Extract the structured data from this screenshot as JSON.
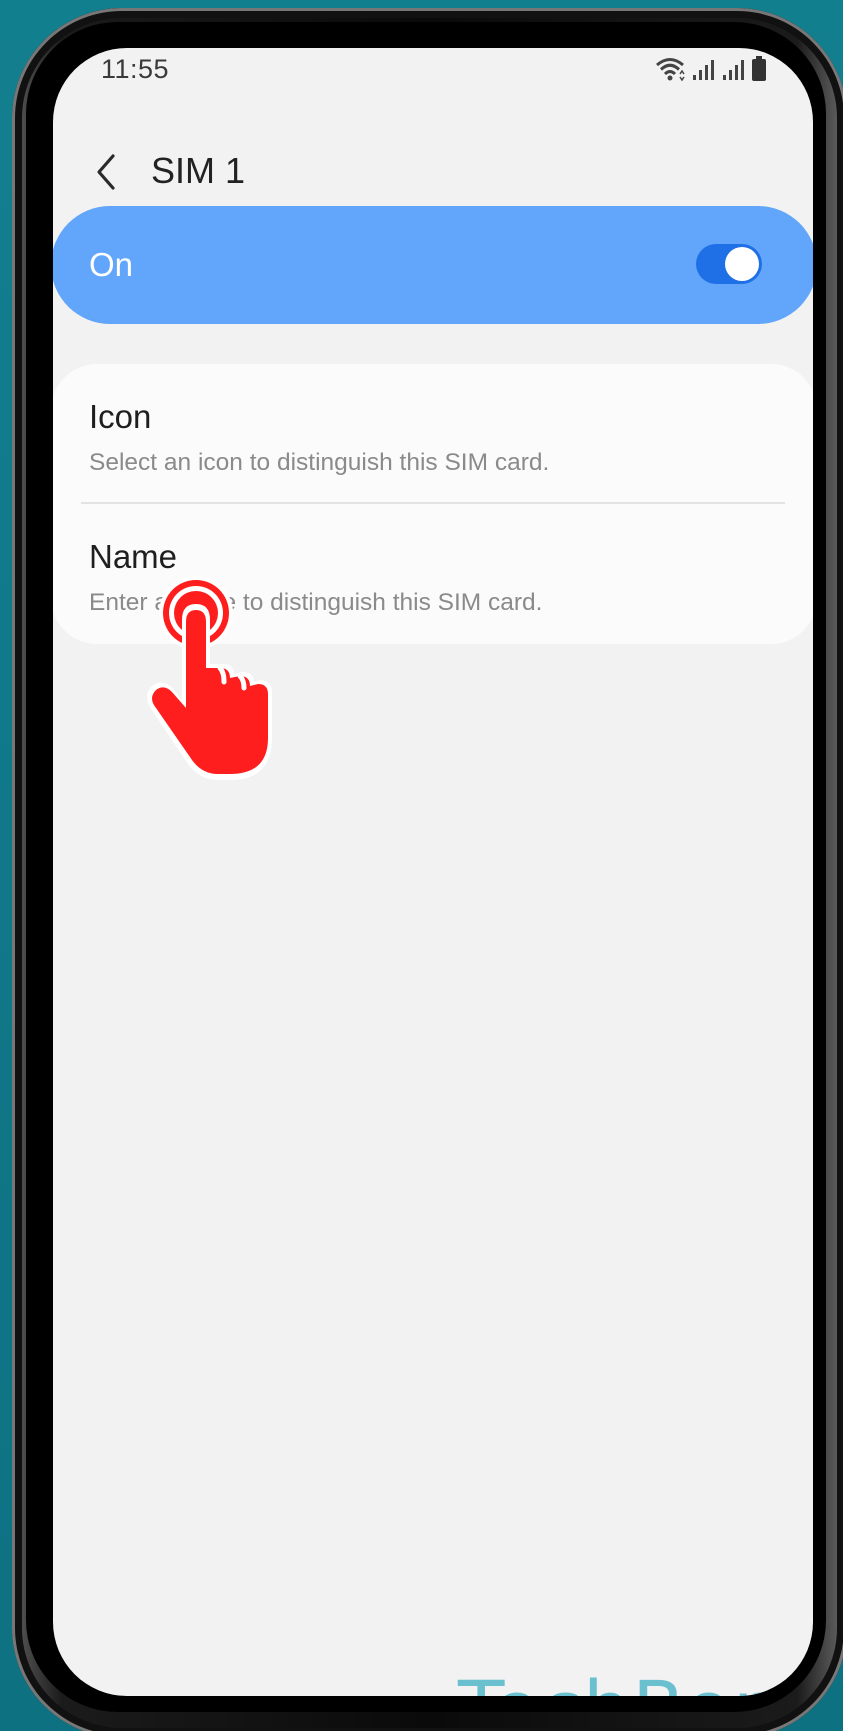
{
  "status_bar": {
    "time": "11:55",
    "icons": [
      "wifi-icon",
      "signal-icon",
      "signal-icon",
      "battery-icon"
    ]
  },
  "header": {
    "back_icon": "chevron-left-icon",
    "title": "SIM 1"
  },
  "master_switch": {
    "label": "On",
    "state": "on",
    "track_color": "#1f6fe6",
    "background_color": "#62a6fb"
  },
  "settings": {
    "items": [
      {
        "title": "Icon",
        "subtitle": "Select an icon to distinguish this SIM card."
      },
      {
        "title": "Name",
        "subtitle": "Enter a name to distinguish this SIM card."
      }
    ]
  },
  "overlay": {
    "tap_indicator_icon": "tap-hand-icon",
    "tap_indicator_color": "#ff1e1e"
  },
  "watermark": {
    "text": "TechBone",
    "color": "#6bc0cf"
  }
}
